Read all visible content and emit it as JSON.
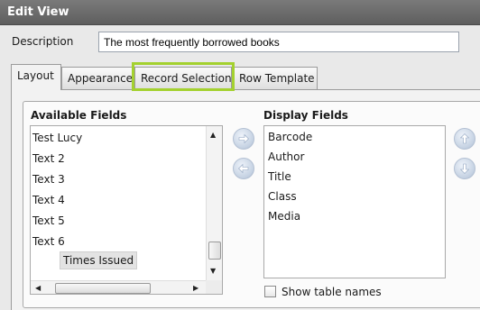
{
  "window": {
    "title": "Edit View"
  },
  "description": {
    "label": "Description",
    "value": "The most frequently borrowed books"
  },
  "tabs": [
    {
      "label": "Layout",
      "active": true
    },
    {
      "label": "Appearance",
      "active": false
    },
    {
      "label": "Record Selection",
      "active": false,
      "highlighted": true
    },
    {
      "label": "Row Template",
      "active": false
    }
  ],
  "highlight_color": "#a4d12f",
  "available_fields": {
    "title": "Available Fields",
    "items": [
      "Test Lucy",
      "Text 2",
      "Text 3",
      "Text 4",
      "Text 5",
      "Text 6",
      "Times Issued"
    ],
    "selected": "Times Issued"
  },
  "display_fields": {
    "title": "Display Fields",
    "items": [
      "Barcode",
      "Author",
      "Title",
      "Class",
      "Media"
    ]
  },
  "buttons": {
    "add": "arrow-right-icon",
    "remove": "arrow-left-icon",
    "move_up": "arrow-up-icon",
    "move_down": "arrow-down-icon"
  },
  "show_table_names": {
    "label": "Show table names",
    "checked": false
  }
}
